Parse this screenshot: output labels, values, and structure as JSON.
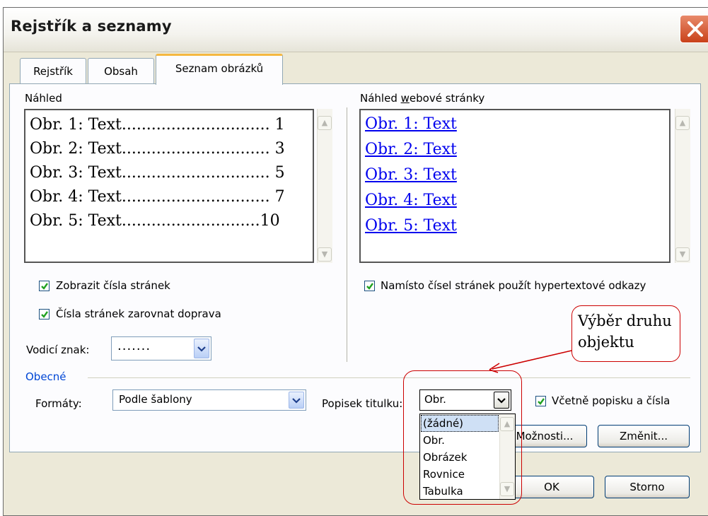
{
  "window": {
    "title": "Rejstřík a seznamy"
  },
  "tabs": [
    {
      "label": "Rejstřík"
    },
    {
      "label": "Obsah"
    },
    {
      "label": "Seznam obrázků",
      "active": true
    }
  ],
  "print_preview": {
    "label": "Náhled",
    "lines": [
      {
        "text": "Obr. 1: Text",
        "dots": "..............................",
        "page": "1"
      },
      {
        "text": "Obr. 2: Text",
        "dots": "..............................",
        "page": "3"
      },
      {
        "text": "Obr. 3: Text",
        "dots": "..............................",
        "page": "5"
      },
      {
        "text": "Obr. 4: Text",
        "dots": "..............................",
        "page": "7"
      },
      {
        "text": "Obr. 5: Text",
        "dots": "............................",
        "page": "10"
      }
    ]
  },
  "web_preview": {
    "label": "Náhled webové stránky",
    "links": [
      "Obr. 1: Text",
      "Obr. 2: Text",
      "Obr. 3: Text",
      "Obr. 4: Text",
      "Obr. 5: Text"
    ]
  },
  "options": {
    "show_page_numbers": {
      "label": "Zobrazit čísla stránek",
      "checked": true
    },
    "right_align": {
      "label": "Čísla stránek zarovnat doprava",
      "checked": true
    },
    "use_hyperlinks": {
      "label": "Namísto čísel stránek použít hypertextové odkazy",
      "checked": true
    },
    "tab_leader": {
      "label": "Vodicí znak:",
      "value": "......."
    }
  },
  "general": {
    "section_label": "Obecné",
    "formats": {
      "label": "Formáty:",
      "value": "Podle šablony"
    },
    "caption_label": {
      "label": "Popisek titulku:",
      "value": "Obr."
    },
    "include_label": {
      "label": "Včetně popisku a čísla",
      "checked": true
    },
    "caption_options": [
      "(žádné)",
      "Obr.",
      "Obrázek",
      "Rovnice",
      "Tabulka"
    ]
  },
  "buttons": {
    "options": "Možnosti...",
    "modify": "Změnit...",
    "ok": "OK",
    "cancel": "Storno"
  },
  "annotation": {
    "line1": "Výběr druhu",
    "line2": "objektu"
  },
  "colors": {
    "link": "#0000ee",
    "tab_accent": "#f5b841",
    "annotation": "#cc0000",
    "close_button": "#c9411a"
  }
}
